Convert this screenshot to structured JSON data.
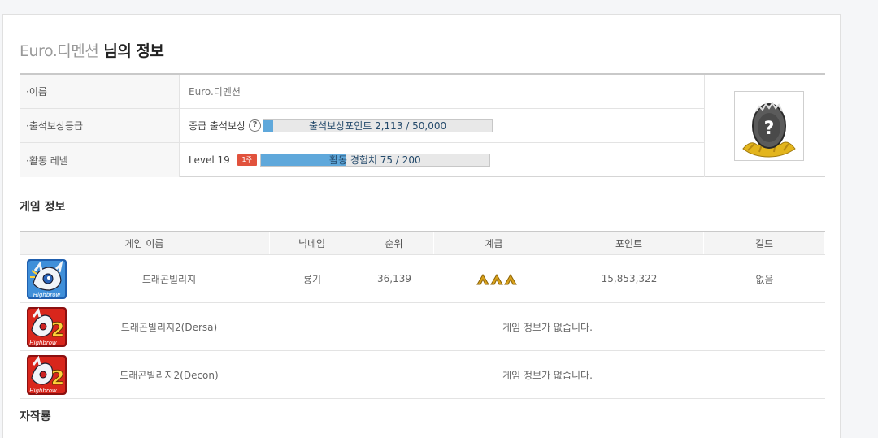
{
  "header": {
    "nickname": "Euro.디멘션",
    "suffix": " 님의 정보"
  },
  "info": {
    "name_label": "·이름",
    "name_value": "Euro.디멘션",
    "attendance_label": "·출석보상등급",
    "attendance_grade": "중급 출석보상",
    "help_glyph": "?",
    "attendance_bar_text": "출석보상포인트 2,113 / 50,000",
    "attendance_progress": 0.0423,
    "activity_label": "·활동 레벨",
    "level_text": "Level 19",
    "level_badge": "1주",
    "activity_bar_text": "활동 경험치 75 / 200",
    "activity_progress": 0.375,
    "avatar_icon": "mystery-egg-icon"
  },
  "game_section": {
    "title": "게임 정보",
    "columns": [
      "게임 이름",
      "닉네임",
      "순위",
      "계급",
      "포인트",
      "길드"
    ],
    "rows": [
      {
        "game": "드래곤빌리지",
        "nickname": "룡기",
        "rank": "36,139",
        "grade_icon": "triple-chevron-rank-icon",
        "points": "15,853,322",
        "guild": "없음",
        "icon": "dragon-village-icon",
        "icon_label": "Highbrow"
      },
      {
        "game": "드래곤빌리지2(Dersa)",
        "message": "게임 정보가 없습니다.",
        "icon": "dragon-village-2-icon",
        "icon_label": "Highbrow",
        "icon_badge": "2"
      },
      {
        "game": "드래곤빌리지2(Decon)",
        "message": "게임 정보가 없습니다.",
        "icon": "dragon-village-2-icon",
        "icon_label": "Highbrow",
        "icon_badge": "2"
      }
    ]
  },
  "craft_section": {
    "title": "자작룡"
  },
  "colors": {
    "bar_fill": "#5fa8db",
    "level_badge": "#e1523d",
    "rank_gold": "#d9a21b"
  }
}
